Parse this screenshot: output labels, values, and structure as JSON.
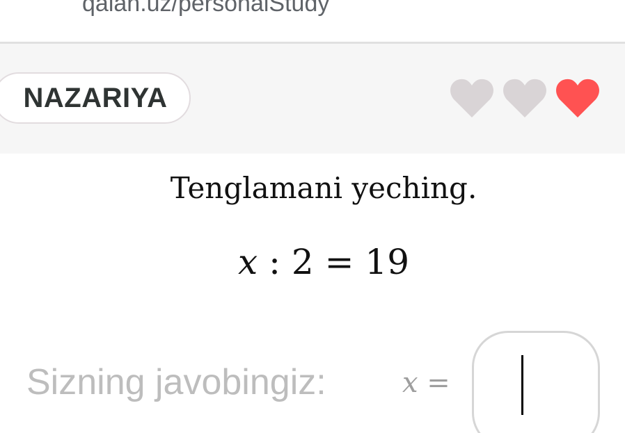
{
  "browser": {
    "url": "qalan.uz/personalStudy"
  },
  "toolbar": {
    "theory_label": "NAZARIYA",
    "lives": [
      {
        "state": "lost",
        "color": "#d9d4d6",
        "icon": "heart-icon"
      },
      {
        "state": "lost",
        "color": "#d9d4d6",
        "icon": "heart-icon"
      },
      {
        "state": "active",
        "color": "#ff5252",
        "icon": "heart-icon"
      }
    ]
  },
  "task": {
    "instruction": "Tenglamani yeching.",
    "equation": {
      "variable": "x",
      "operator": ":",
      "divisor": "2",
      "equals": "=",
      "result": "19"
    }
  },
  "answer": {
    "label": "Sizning javobingiz:",
    "variable": "x",
    "equals": "=",
    "value": ""
  }
}
